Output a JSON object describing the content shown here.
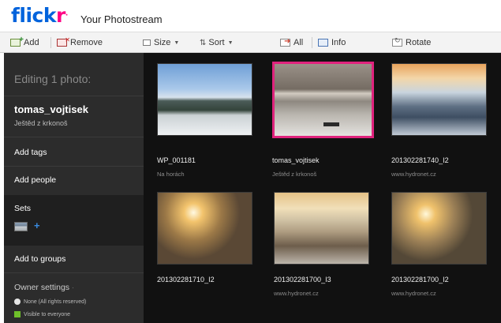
{
  "header": {
    "logo_blue": "flick",
    "logo_pink": "r",
    "logo_tm": "·",
    "title": "Your Photostream"
  },
  "toolbar": {
    "add": "Add",
    "remove": "Remove",
    "size": "Size",
    "sort": "Sort",
    "all": "All",
    "info": "Info",
    "rotate": "Rotate"
  },
  "sidebar": {
    "heading": "Editing 1 photo:",
    "owner": "tomas_vojtisek",
    "owner_subtitle": "Ještěd z krkonoš",
    "add_tags": "Add tags",
    "add_people": "Add people",
    "sets": "Sets",
    "add_set_icon": "+",
    "add_to_groups": "Add to groups",
    "owner_settings": "Owner settings",
    "owner_settings_caret": "·",
    "rights": "None (All rights reserved)",
    "visibility": "Visible to everyone"
  },
  "photos": [
    {
      "title": "WP_001181",
      "subtitle": "Na horách",
      "selected": false,
      "art": "snowy-forest-hills"
    },
    {
      "title": "tomas_vojtisek",
      "subtitle": "Ještěd z krkonoš",
      "selected": true,
      "art": "fog-valley-hut"
    },
    {
      "title": "201302281740_I2",
      "subtitle": "www.hydronet.cz",
      "selected": false,
      "art": "sunset-sea-of-clouds"
    },
    {
      "title": "201302281710_I2",
      "subtitle": "",
      "selected": false,
      "art": "sunset-snow-slope"
    },
    {
      "title": "201302281700_I3",
      "subtitle": "www.hydronet.cz",
      "selected": false,
      "art": "golden-clouds"
    },
    {
      "title": "201302281700_I2",
      "subtitle": "www.hydronet.cz",
      "selected": false,
      "art": "sunset-snow-slope"
    }
  ],
  "colors": {
    "brand_blue": "#0063dc",
    "brand_pink": "#ff0084",
    "selection": "#e0237d",
    "sidebar_bg": "#2c2c2c",
    "grid_bg": "#111111"
  }
}
